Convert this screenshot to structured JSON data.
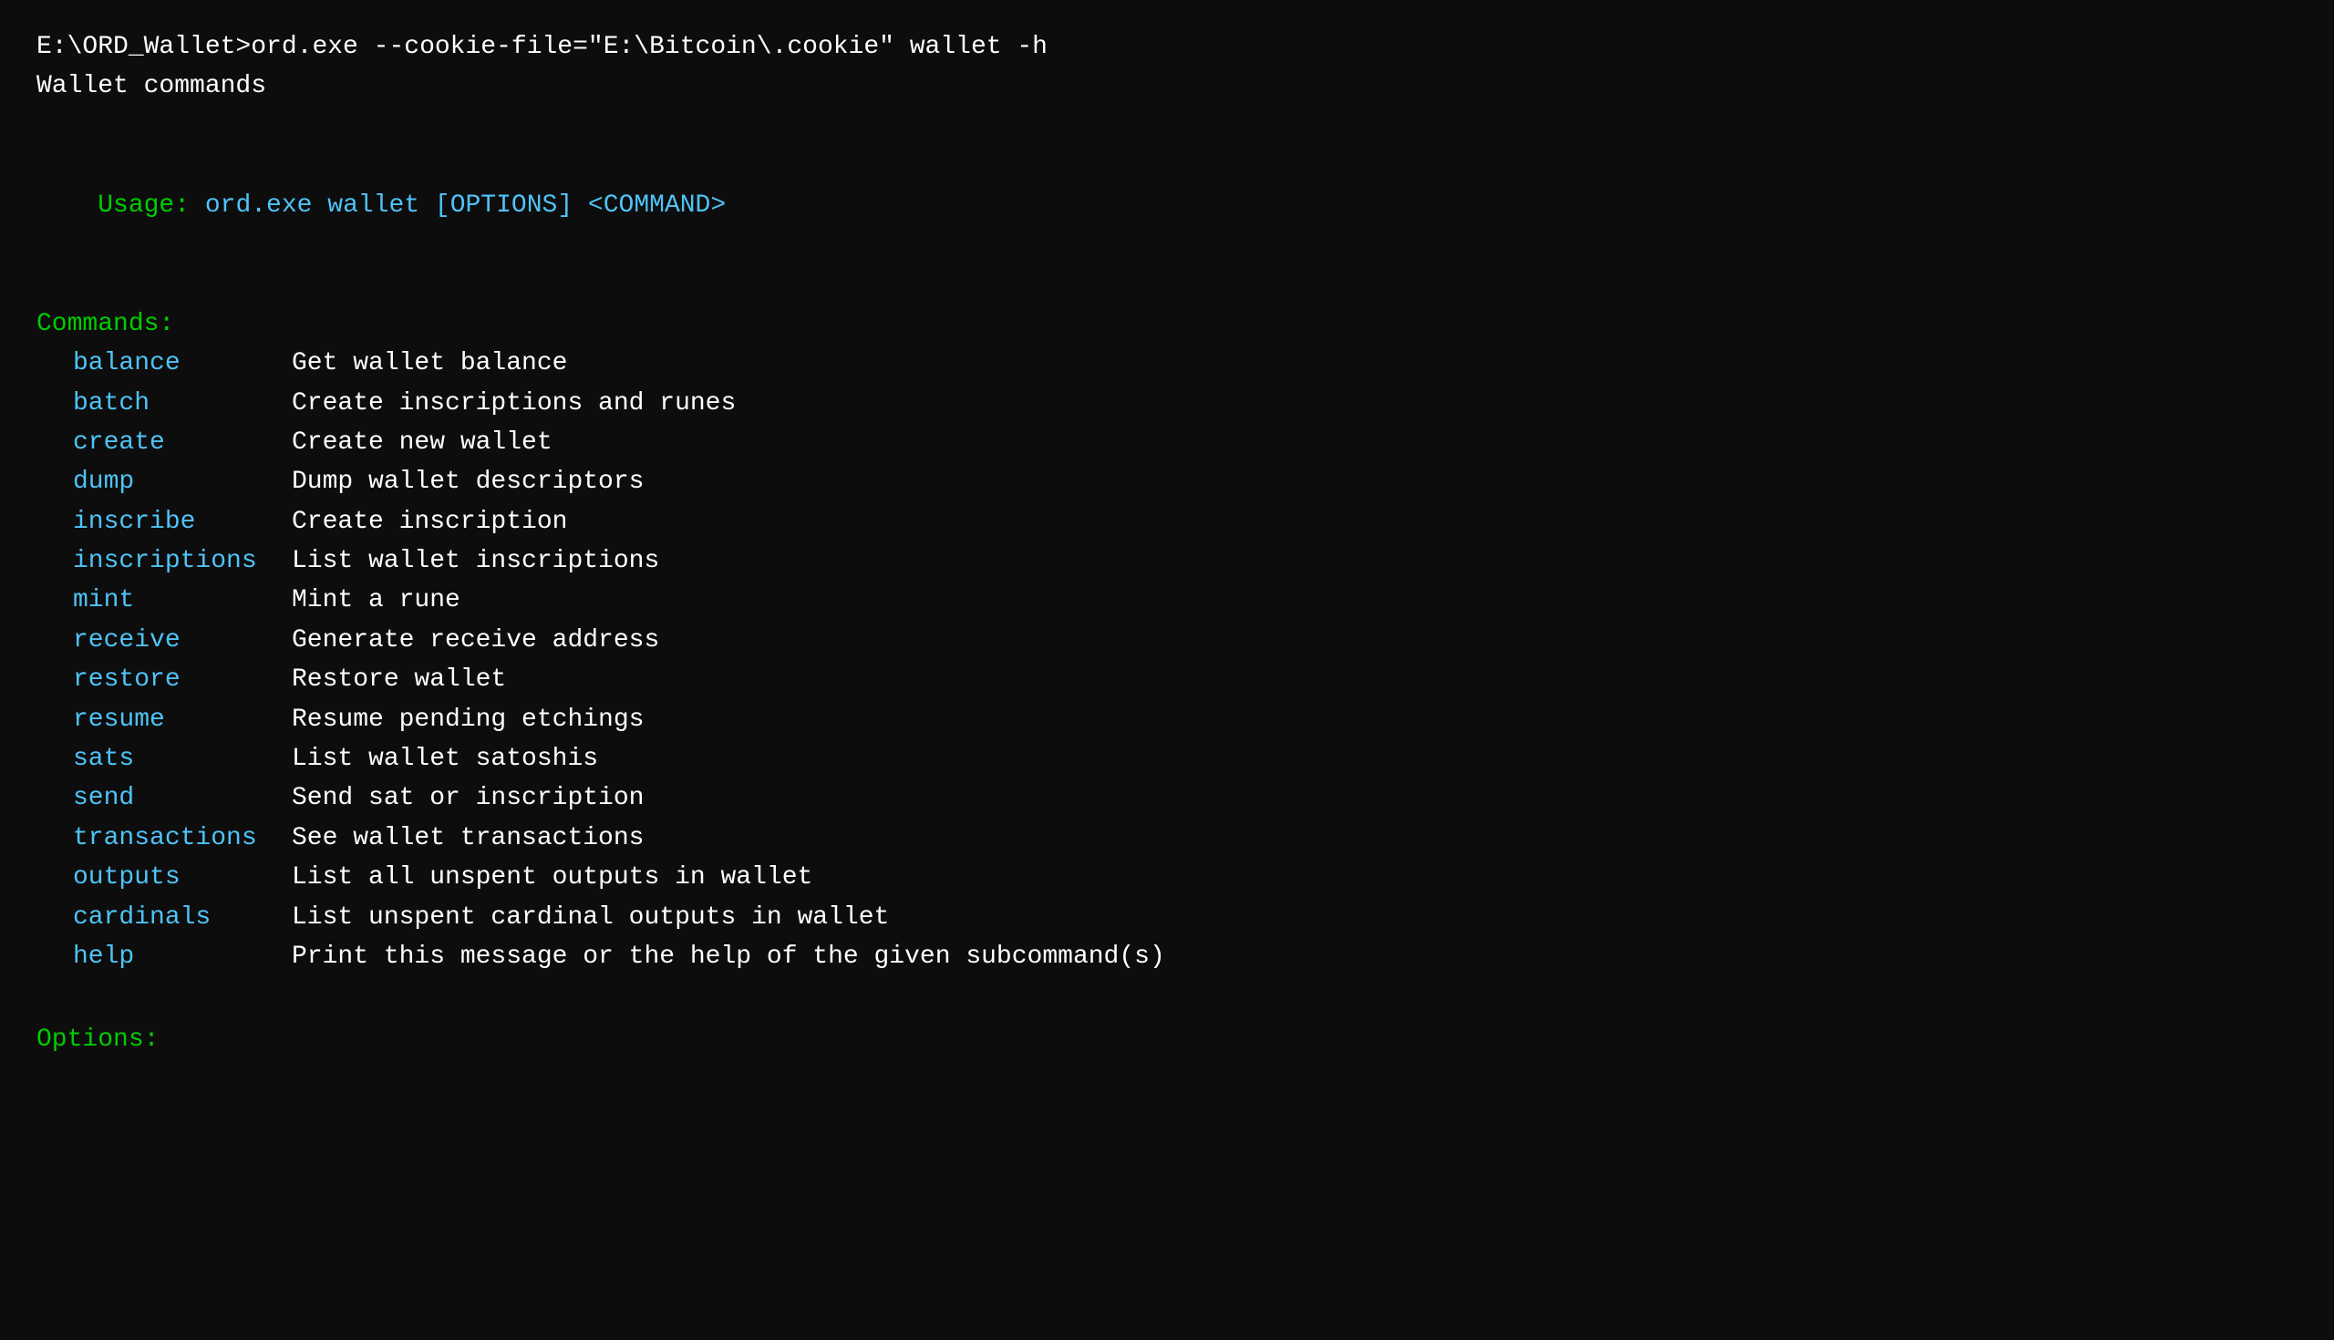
{
  "terminal": {
    "prompt_line": "E:\\ORD_Wallet>ord.exe --cookie-file=\"E:\\Bitcoin\\.cookie\" wallet -h",
    "wallet_commands_label": "Wallet commands",
    "blank": "",
    "usage": {
      "prefix": "Usage: ",
      "command": "ord.exe wallet",
      "options": " [OPTIONS] <COMMAND>"
    },
    "commands_header": "Commands:",
    "commands": [
      {
        "name": "balance",
        "desc": "Get wallet balance"
      },
      {
        "name": "batch",
        "desc": "Create inscriptions and runes"
      },
      {
        "name": "create",
        "desc": "Create new wallet"
      },
      {
        "name": "dump",
        "desc": "Dump wallet descriptors"
      },
      {
        "name": "inscribe",
        "desc": "Create inscription"
      },
      {
        "name": "inscriptions",
        "desc": "List wallet inscriptions"
      },
      {
        "name": "mint",
        "desc": "Mint a rune"
      },
      {
        "name": "receive",
        "desc": "Generate receive address"
      },
      {
        "name": "restore",
        "desc": "Restore wallet"
      },
      {
        "name": "resume",
        "desc": "Resume pending etchings"
      },
      {
        "name": "sats",
        "desc": "List wallet satoshis"
      },
      {
        "name": "send",
        "desc": "Send sat or inscription"
      },
      {
        "name": "transactions",
        "desc": "See wallet transactions"
      },
      {
        "name": "outputs",
        "desc": "List all unspent outputs in wallet"
      },
      {
        "name": "cardinals",
        "desc": "List unspent cardinal outputs in wallet"
      },
      {
        "name": "help",
        "desc": "Print this message or the help of the given subcommand(s)"
      }
    ],
    "options_header": "Options:"
  }
}
